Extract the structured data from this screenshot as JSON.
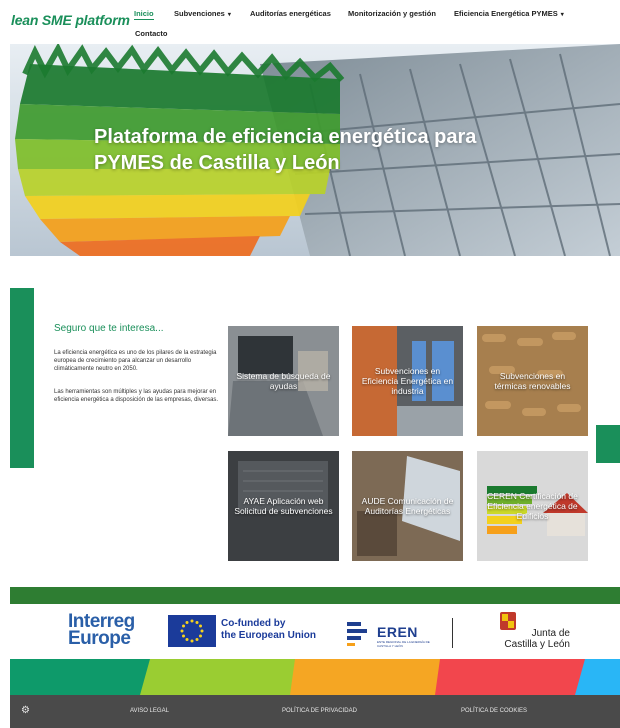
{
  "header": {
    "logo": "lean SME platform",
    "nav": [
      {
        "label": "Inicio",
        "active": true
      },
      {
        "label": "Subvenciones",
        "dropdown": true
      },
      {
        "label": "Auditorías energéticas"
      },
      {
        "label": "Monitorización y gestión"
      },
      {
        "label": "Eficiencia Energética PYMES",
        "dropdown": true
      },
      {
        "label": "Contacto"
      }
    ],
    "caret_glyph": "▾"
  },
  "hero": {
    "title_line1": "Plataforma de eficiencia energética para",
    "title_line2": "PYMES de Castilla y León"
  },
  "intro": {
    "title": "Seguro que te interesa...",
    "paragraph1": "La eficiencia energética es uno de los pilares de la estrategia europea de crecimiento para alcanzar un desarrollo climáticamente neutro en 2050.",
    "paragraph2": "Las herramientas son múltiples y las ayudas para mejorar en eficiencia energética a disposición de las empresas, diversas."
  },
  "cards": [
    {
      "label": "Sistema de búsqueda de ayudas"
    },
    {
      "label": "Subvenciones en Eficiencia Energética en industria"
    },
    {
      "label": "Subvenciones en térmicas renovables"
    },
    {
      "label": "AYAE Aplicación web Solicitud de subvenciones"
    },
    {
      "label": "AUDE Comunicación de Auditorías Energéticas"
    },
    {
      "label": "CEREN Certificación de Eficiencia energética de Edificios"
    }
  ],
  "partners": {
    "interreg_line1": "Interreg",
    "interreg_line2": "Europe",
    "cofunded_line1": "Co-funded by",
    "cofunded_line2": "the European Union",
    "eren": "EREN",
    "eren_sub": "ENTE REGIONAL DE LA ENERGÍA DE CASTILLA Y LEÓN",
    "jcyl_line1": "Junta de",
    "jcyl_line2": "Castilla y León"
  },
  "footer": {
    "links": [
      "AVISO LEGAL",
      "POLÍTICA DE PRIVACIDAD",
      "POLÍTICA DE COOKIES"
    ],
    "settings_icon": "gear-icon"
  },
  "colors": {
    "brand_green": "#1a8f5a",
    "band": [
      "#0e9a6a",
      "#9acd32",
      "#f5a623",
      "#f2464d",
      "#29b6f6"
    ],
    "footer_bg": "#4a4a4a"
  }
}
